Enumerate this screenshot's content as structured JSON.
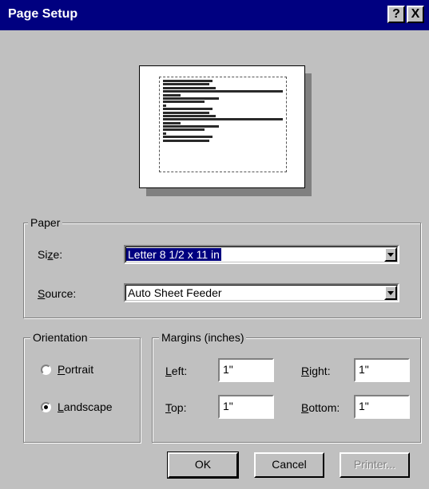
{
  "window": {
    "title": "Page Setup",
    "help_button": "?",
    "close_button": "X"
  },
  "paper": {
    "legend": "Paper",
    "size_label": "Size:",
    "size_value": "Letter 8 1/2 x 11 in",
    "source_label": "Source:",
    "source_value": "Auto Sheet Feeder"
  },
  "orientation": {
    "legend": "Orientation",
    "portrait_label": "Portrait",
    "landscape_label": "Landscape",
    "selected": "Landscape"
  },
  "margins": {
    "legend": "Margins (inches)",
    "left_label": "Left:",
    "left_value": "1\"",
    "right_label": "Right:",
    "right_value": "1\"",
    "top_label": "Top:",
    "top_value": "1\"",
    "bottom_label": "Bottom:",
    "bottom_value": "1\""
  },
  "buttons": {
    "ok": "OK",
    "cancel": "Cancel",
    "printer": "Printer..."
  },
  "colors": {
    "title_bar": "#000080",
    "face": "#c0c0c0",
    "selection": "#000080"
  }
}
